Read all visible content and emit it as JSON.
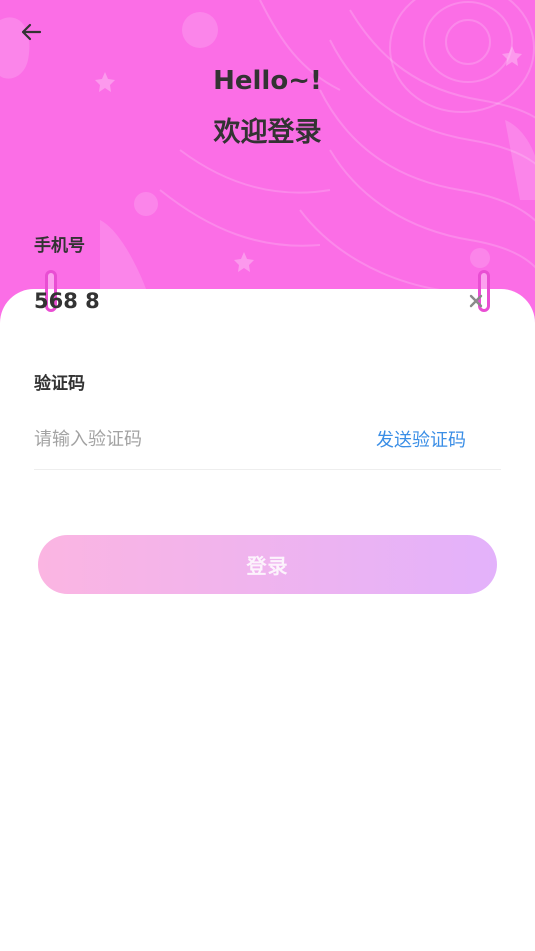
{
  "header": {
    "greeting": "Hello~!",
    "welcome": "欢迎登录"
  },
  "form": {
    "phone": {
      "label": "手机号",
      "value": "568 8"
    },
    "code": {
      "label": "验证码",
      "placeholder": "请输入验证码",
      "value": "",
      "send_label": "发送验证码"
    }
  },
  "actions": {
    "login_label": "登录"
  },
  "colors": {
    "hero_background": "#fb6ee6",
    "accent_link": "#3a8ee6",
    "button_gradient_start": "#fbb5e2",
    "button_gradient_end": "#e3b2fb",
    "text_primary": "#333333",
    "placeholder": "#a3a3a3"
  },
  "icons": {
    "back": "arrow-left-icon",
    "clear": "close-icon"
  }
}
